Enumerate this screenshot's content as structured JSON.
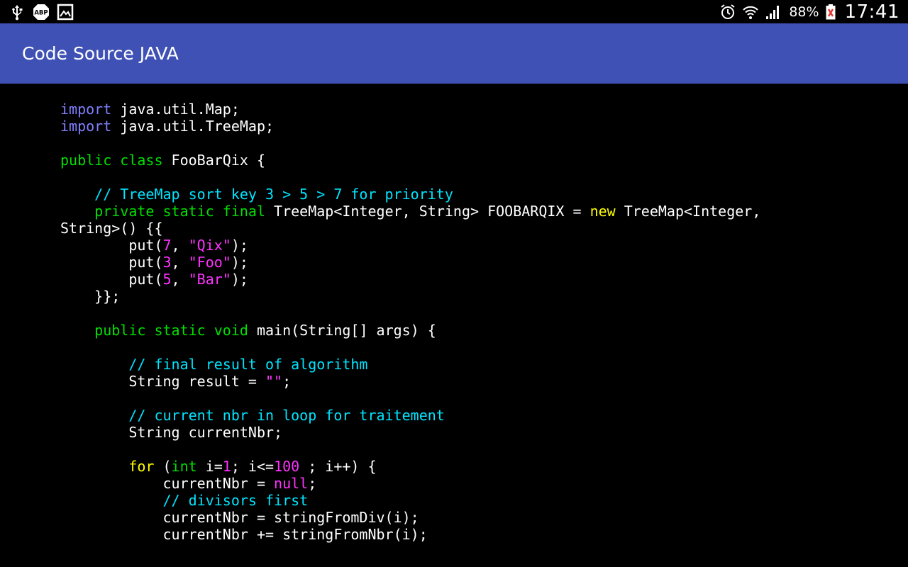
{
  "status_bar": {
    "left_icons": [
      "usb-icon",
      "adblock-plus-icon",
      "gallery-icon"
    ],
    "adblock_label": "ABP",
    "right_icons": [
      "alarm-clock-icon",
      "wifi-icon",
      "cellular-signal-icon"
    ],
    "battery_percent": "88%",
    "battery_icon": "battery-icon",
    "time": "17:41"
  },
  "app_bar": {
    "title": "Code Source JAVA",
    "background": "#3f51b5"
  },
  "syntax_colors": {
    "import": "#8080ff",
    "keyword": "#00e000",
    "comment": "#00e5ff",
    "control": "#ffff00",
    "literal": "#ff33ff",
    "plain": "#ffffff",
    "background": "#000000"
  },
  "code": {
    "lines": [
      [
        {
          "t": "import",
          "c": "import"
        },
        {
          "t": " java.util.Map;",
          "c": "plain"
        }
      ],
      [
        {
          "t": "import",
          "c": "import"
        },
        {
          "t": " java.util.TreeMap;",
          "c": "plain"
        }
      ],
      [],
      [
        {
          "t": "public class",
          "c": "keyword"
        },
        {
          "t": " FooBarQix {",
          "c": "plain"
        }
      ],
      [],
      [
        {
          "t": "    // TreeMap sort key 3 > 5 > 7 for priority",
          "c": "comment"
        }
      ],
      [
        {
          "t": "    ",
          "c": "plain"
        },
        {
          "t": "private static final",
          "c": "keyword"
        },
        {
          "t": " TreeMap<Integer, String> FOOBARQIX = ",
          "c": "plain"
        },
        {
          "t": "new",
          "c": "control"
        },
        {
          "t": " TreeMap<Integer,",
          "c": "plain"
        }
      ],
      [
        {
          "t": "String>() {{",
          "c": "plain"
        }
      ],
      [
        {
          "t": "        put(",
          "c": "plain"
        },
        {
          "t": "7",
          "c": "literal"
        },
        {
          "t": ", ",
          "c": "plain"
        },
        {
          "t": "\"Qix\"",
          "c": "literal"
        },
        {
          "t": ");",
          "c": "plain"
        }
      ],
      [
        {
          "t": "        put(",
          "c": "plain"
        },
        {
          "t": "3",
          "c": "literal"
        },
        {
          "t": ", ",
          "c": "plain"
        },
        {
          "t": "\"Foo\"",
          "c": "literal"
        },
        {
          "t": ");",
          "c": "plain"
        }
      ],
      [
        {
          "t": "        put(",
          "c": "plain"
        },
        {
          "t": "5",
          "c": "literal"
        },
        {
          "t": ", ",
          "c": "plain"
        },
        {
          "t": "\"Bar\"",
          "c": "literal"
        },
        {
          "t": ");",
          "c": "plain"
        }
      ],
      [
        {
          "t": "    }};",
          "c": "plain"
        }
      ],
      [],
      [
        {
          "t": "    ",
          "c": "plain"
        },
        {
          "t": "public static void",
          "c": "keyword"
        },
        {
          "t": " main(String[] args) {",
          "c": "plain"
        }
      ],
      [],
      [
        {
          "t": "        // final result of algorithm",
          "c": "comment"
        }
      ],
      [
        {
          "t": "        String result = ",
          "c": "plain"
        },
        {
          "t": "\"\"",
          "c": "literal"
        },
        {
          "t": ";",
          "c": "plain"
        }
      ],
      [],
      [
        {
          "t": "        // current nbr in loop for traitement",
          "c": "comment"
        }
      ],
      [
        {
          "t": "        String currentNbr;",
          "c": "plain"
        }
      ],
      [],
      [
        {
          "t": "        ",
          "c": "plain"
        },
        {
          "t": "for",
          "c": "control"
        },
        {
          "t": " (",
          "c": "plain"
        },
        {
          "t": "int",
          "c": "keyword"
        },
        {
          "t": " i=",
          "c": "plain"
        },
        {
          "t": "1",
          "c": "literal"
        },
        {
          "t": "; i<=",
          "c": "plain"
        },
        {
          "t": "100",
          "c": "literal"
        },
        {
          "t": " ; i++) {",
          "c": "plain"
        }
      ],
      [
        {
          "t": "            currentNbr = ",
          "c": "plain"
        },
        {
          "t": "null",
          "c": "literal"
        },
        {
          "t": ";",
          "c": "plain"
        }
      ],
      [
        {
          "t": "            // divisors first",
          "c": "comment"
        }
      ],
      [
        {
          "t": "            currentNbr = stringFromDiv(i);",
          "c": "plain"
        }
      ],
      [
        {
          "t": "            currentNbr += stringFromNbr(i);",
          "c": "plain"
        }
      ]
    ]
  }
}
